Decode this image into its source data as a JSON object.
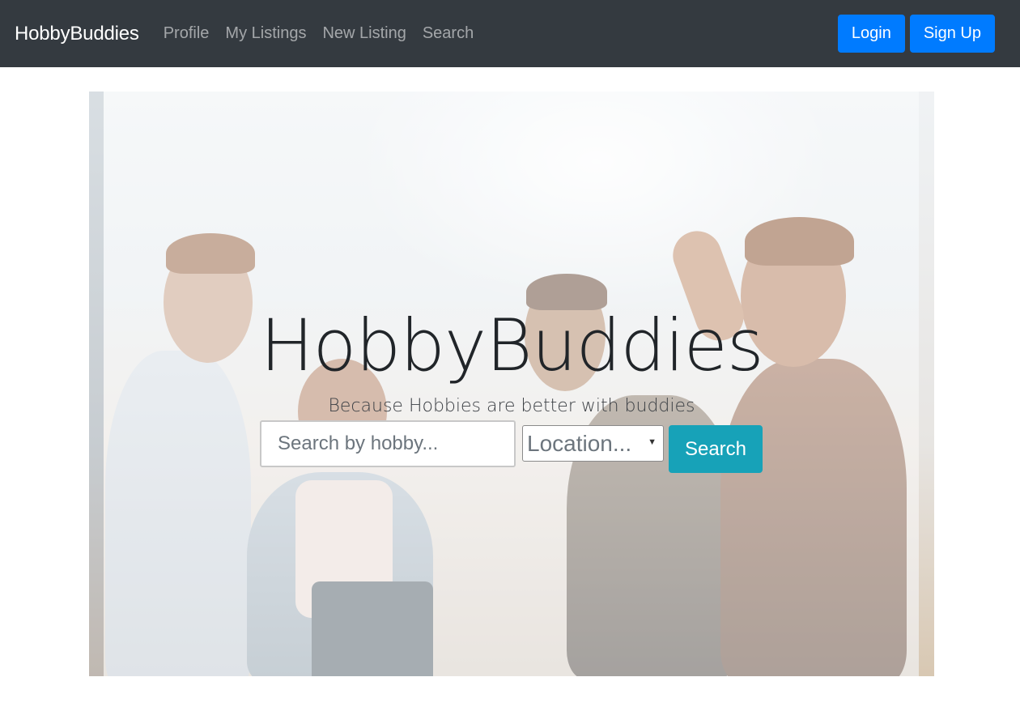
{
  "navbar": {
    "brand": "HobbyBuddies",
    "links": [
      "Profile",
      "My Listings",
      "New Listing",
      "Search"
    ],
    "login_label": "Login",
    "signup_label": "Sign Up"
  },
  "hero": {
    "title": "HobbyBuddies",
    "subtitle": "Because Hobbies are better with buddies",
    "search_placeholder": "Search by hobby...",
    "location_value": "Location...",
    "search_button": "Search"
  },
  "colors": {
    "navbar_bg": "#343a40",
    "primary": "#007bff",
    "info": "#17a2b8"
  }
}
